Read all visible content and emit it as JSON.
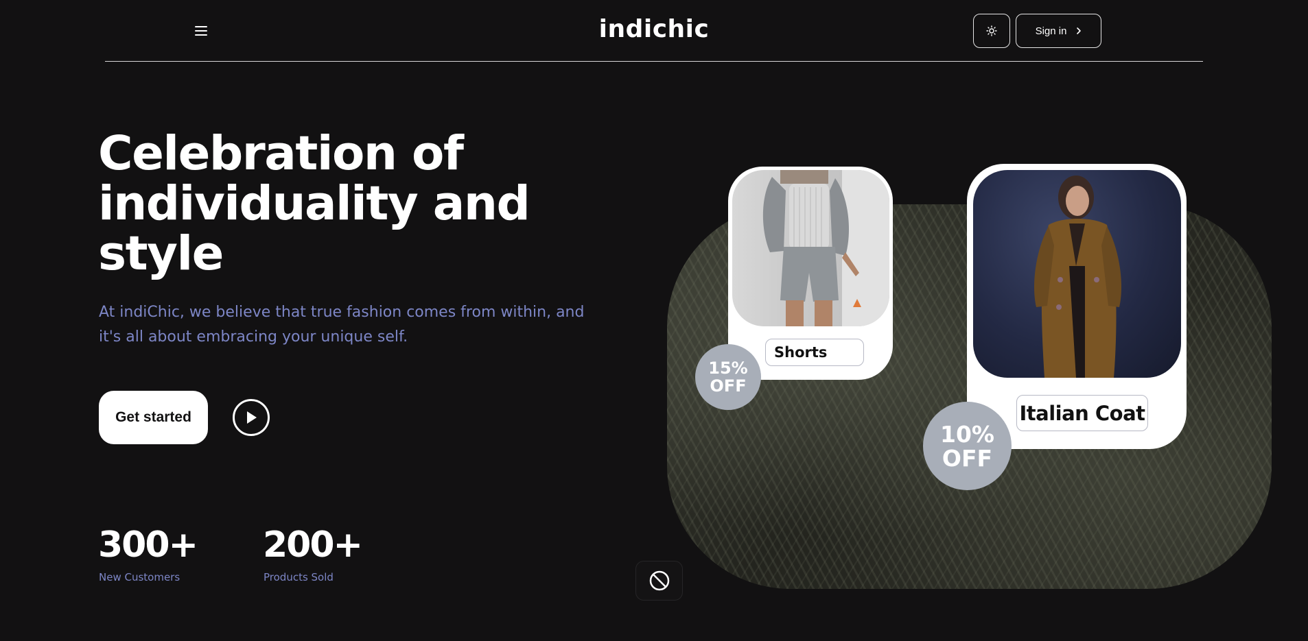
{
  "header": {
    "logo": "indichic",
    "signin_label": "Sign in",
    "menu_icon": "menu-icon",
    "theme_icon": "sun-icon",
    "signin_icon": "chevron-right-icon"
  },
  "hero": {
    "headline": "Celebration of individuality and style",
    "subtext": "At indiChic, we believe that true fashion comes from within, and it's all about embracing your unique self.",
    "cta_label": "Get started",
    "play_icon": "play-icon"
  },
  "stats": [
    {
      "value": "300+",
      "label": "New Customers"
    },
    {
      "value": "200+",
      "label": "Products Sold"
    }
  ],
  "products": [
    {
      "name": "Shorts",
      "discount_pct": "15%",
      "discount_word": "OFF"
    },
    {
      "name": "Italian Coat",
      "discount_pct": "10%",
      "discount_word": "OFF"
    }
  ],
  "colors": {
    "background": "#121112",
    "accent_text": "#7d86c6",
    "badge": "#a8aeb8",
    "white": "#ffffff"
  },
  "floating_icon": "block-icon"
}
